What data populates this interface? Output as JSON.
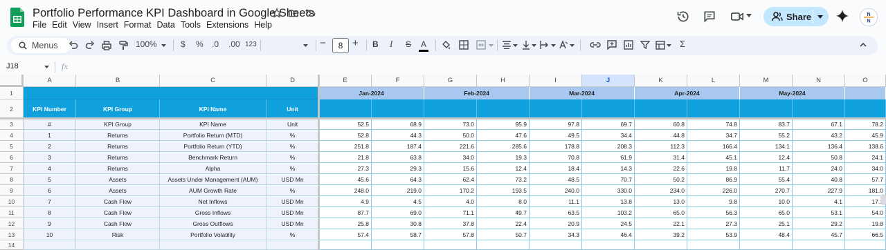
{
  "app": {
    "doc_title": "Portfolio Performance KPI Dashboard in Google Sheets",
    "menu": [
      "File",
      "Edit",
      "View",
      "Insert",
      "Format",
      "Data",
      "Tools",
      "Extensions",
      "Help"
    ],
    "share_label": "Share",
    "avatar_text": "N\nN",
    "accent_color": "#10a0dc"
  },
  "toolbar": {
    "menus_label": "Menus",
    "zoom": "100%",
    "currency": "$",
    "percent": "%",
    "dec_decrease": ".0",
    "dec_increase": ".00",
    "number_format": "123",
    "font_size": "8",
    "bold": "B",
    "italic": "I",
    "strike": "S",
    "text_color": "A",
    "sigma": "Σ"
  },
  "formula_bar": {
    "name_box": "J18",
    "fx": "fx"
  },
  "grid": {
    "columns": [
      "A",
      "B",
      "C",
      "D",
      "E",
      "F",
      "G",
      "H",
      "I",
      "J",
      "K",
      "L",
      "M",
      "N",
      "O"
    ],
    "selected_column": "J",
    "row_numbers": [
      "1",
      "2",
      "3",
      "4",
      "5",
      "6",
      "7",
      "8",
      "9",
      "10",
      "11",
      "12",
      "13",
      "14"
    ],
    "months": [
      "Jan-2024",
      "Feb-2024",
      "Mar-2024",
      "Apr-2024",
      "May-2024"
    ],
    "headers": [
      "KPI Number",
      "KPI Group",
      "KPI Name",
      "Unit"
    ],
    "rows": [
      [
        "#",
        "KPI Group",
        "KPI Name",
        "Unit",
        "52.5",
        "68.9",
        "73.0",
        "95.9",
        "97.8",
        "69.7",
        "60.8",
        "74.8",
        "83.7",
        "67.1",
        "78.2"
      ],
      [
        "1",
        "Returns",
        "Portfolio Return (MTD)",
        "%",
        "52.8",
        "44.3",
        "50.0",
        "47.6",
        "49.5",
        "34.4",
        "44.8",
        "34.7",
        "55.2",
        "43.2",
        "45.9"
      ],
      [
        "2",
        "Returns",
        "Portfolio Return (YTD)",
        "%",
        "251.8",
        "187.4",
        "221.6",
        "285.6",
        "178.8",
        "208.3",
        "112.3",
        "166.4",
        "134.1",
        "136.4",
        "138.6"
      ],
      [
        "3",
        "Returns",
        "Benchmark Return",
        "%",
        "21.8",
        "63.8",
        "34.0",
        "19.3",
        "70.8",
        "61.9",
        "31.4",
        "45.1",
        "12.4",
        "50.8",
        "24.1"
      ],
      [
        "4",
        "Returns",
        "Alpha",
        "%",
        "27.3",
        "29.3",
        "15.6",
        "12.4",
        "18.4",
        "14.3",
        "22.6",
        "19.8",
        "11.7",
        "24.0",
        "34.0"
      ],
      [
        "5",
        "Assets",
        "Assets Under Management (AUM)",
        "USD Mn",
        "45.6",
        "64.3",
        "62.4",
        "73.2",
        "48.5",
        "70.7",
        "50.2",
        "86.9",
        "55.4",
        "40.8",
        "57.7"
      ],
      [
        "6",
        "Assets",
        "AUM Growth Rate",
        "%",
        "248.0",
        "219.0",
        "170.2",
        "193.5",
        "240.0",
        "330.0",
        "234.0",
        "226.0",
        "270.7",
        "227.9",
        "181.0"
      ],
      [
        "7",
        "Cash Flow",
        "Net Inflows",
        "USD Mn",
        "4.9",
        "4.5",
        "4.0",
        "8.0",
        "11.1",
        "13.8",
        "13.0",
        "9.8",
        "10.0",
        "4.1",
        "17.2"
      ],
      [
        "8",
        "Cash Flow",
        "Gross Inflows",
        "USD Mn",
        "87.7",
        "69.0",
        "71.1",
        "49.7",
        "63.5",
        "103.2",
        "65.0",
        "56.3",
        "65.0",
        "53.1",
        "54.0"
      ],
      [
        "9",
        "Cash Flow",
        "Gross Outflows",
        "USD Mn",
        "25.8",
        "30.8",
        "37.8",
        "22.4",
        "20.9",
        "24.5",
        "22.1",
        "27.3",
        "25.1",
        "29.2",
        "19.8"
      ],
      [
        "10",
        "Risk",
        "Portfolio Volatility",
        "%",
        "57.4",
        "58.7",
        "57.8",
        "50.7",
        "34.3",
        "46.4",
        "39.2",
        "53.9",
        "48.4",
        "45.7",
        "66.5"
      ]
    ]
  }
}
